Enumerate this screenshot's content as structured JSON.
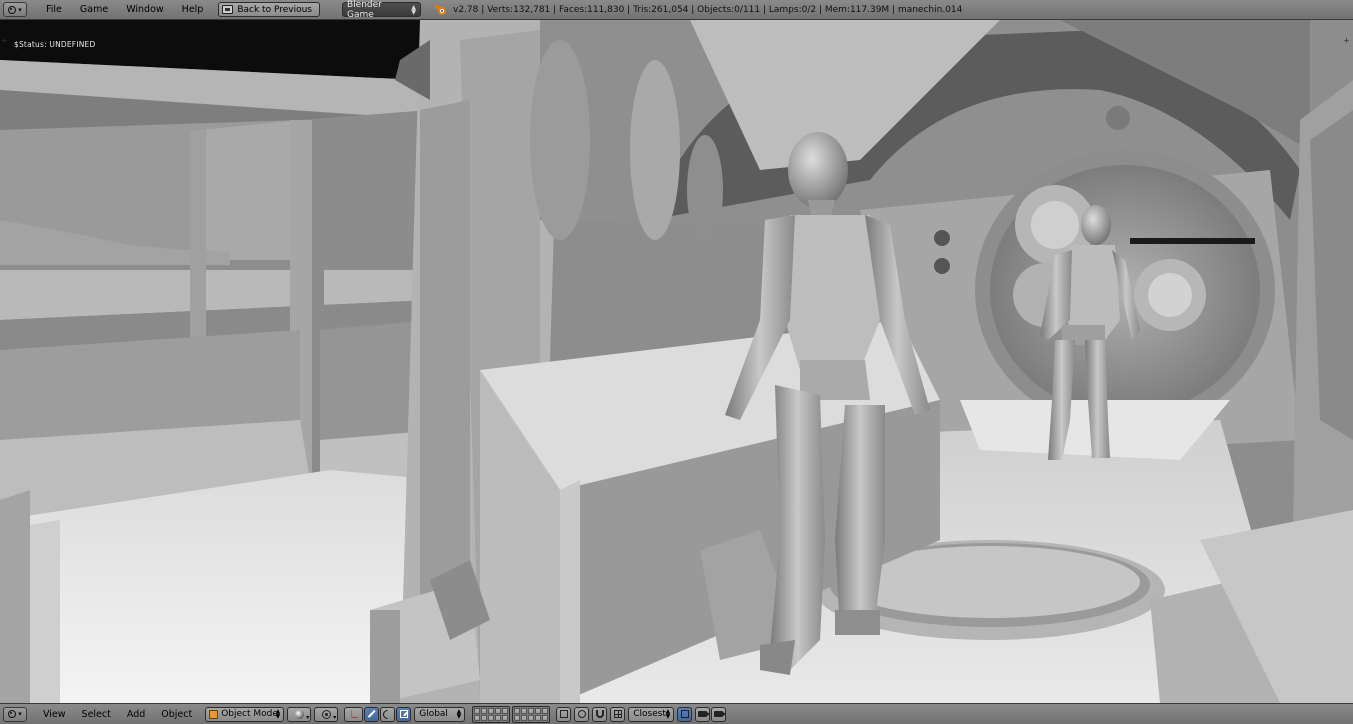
{
  "top_header": {
    "menus": [
      "File",
      "Game",
      "Window",
      "Help"
    ],
    "back_button": "Back to Previous",
    "render_engine": "Blender Game",
    "stats": "v2.78 | Verts:132,781 | Faces:111,830 | Tris:261,054 | Objects:0/111 | Lamps:0/2 | Mem:117.39M | manechin.014"
  },
  "viewport": {
    "status_text": "$Status: UNDEFINED",
    "left_tab_glyph": "+",
    "right_tab_glyph": "+"
  },
  "bottom_header": {
    "menus": [
      "View",
      "Select",
      "Add",
      "Object"
    ],
    "mode": "Object Mode",
    "orientation": "Global",
    "snap_target": "Closest"
  },
  "icons": {
    "editor_type": "3d-view-icon",
    "blender_logo": "blender-logo-icon",
    "viewport_shading": "solid-shading-icon",
    "pivot": "pivot-point-icon",
    "manipulator": "manipulator-axes-icon",
    "translate": "translate-arrow-icon",
    "rotate": "rotate-arc-icon",
    "scale": "scale-box-icon",
    "render_preview": "camera-icon"
  },
  "colors": {
    "header_bg": "#7e7e7e",
    "selected_blue": "#5680c2",
    "logo_orange": "#e87d0d"
  }
}
